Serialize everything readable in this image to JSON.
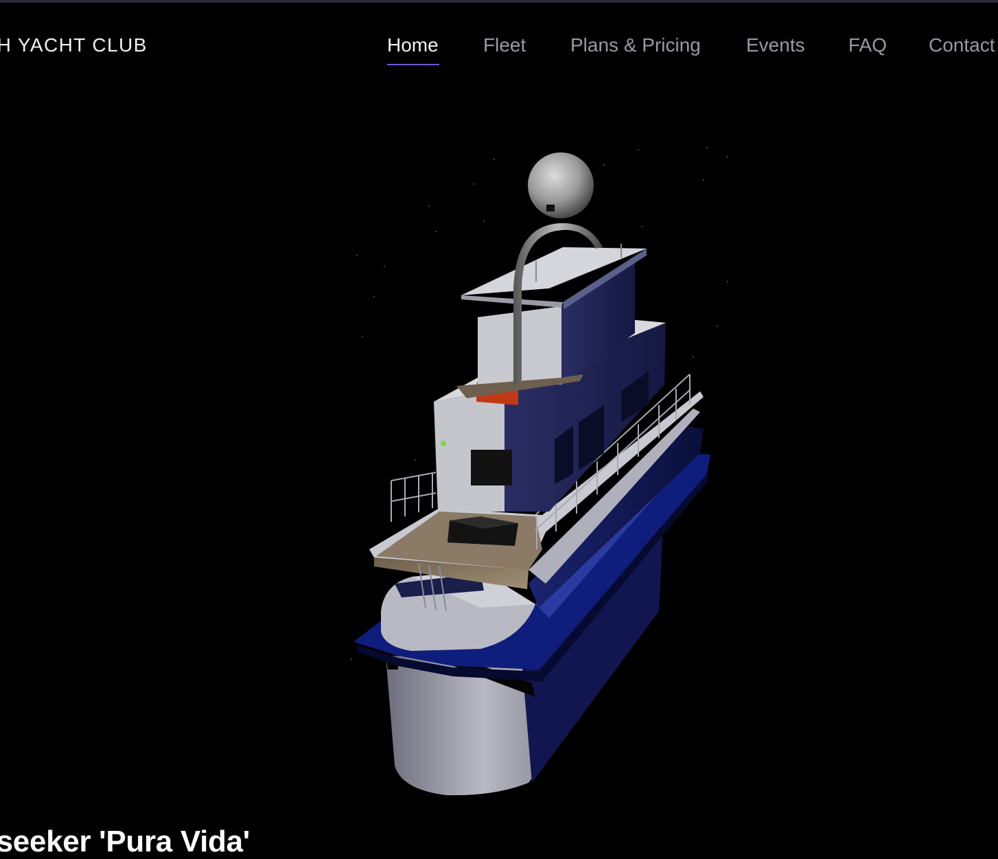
{
  "header": {
    "brand": "CH YACHT CLUB",
    "nav": [
      {
        "label": "Home",
        "active": true
      },
      {
        "label": "Fleet",
        "active": false
      },
      {
        "label": "Plans & Pricing",
        "active": false
      },
      {
        "label": "Events",
        "active": false
      },
      {
        "label": "FAQ",
        "active": false
      },
      {
        "label": "Contact",
        "active": false
      }
    ]
  },
  "hero": {
    "title": "nseeker 'Pura Vida'"
  },
  "colors": {
    "accent_underline": "#6b5bd8",
    "hull_blue": "#0d1a6b",
    "hull_white": "#9a9aa6",
    "dome_red": "#c03a15"
  }
}
